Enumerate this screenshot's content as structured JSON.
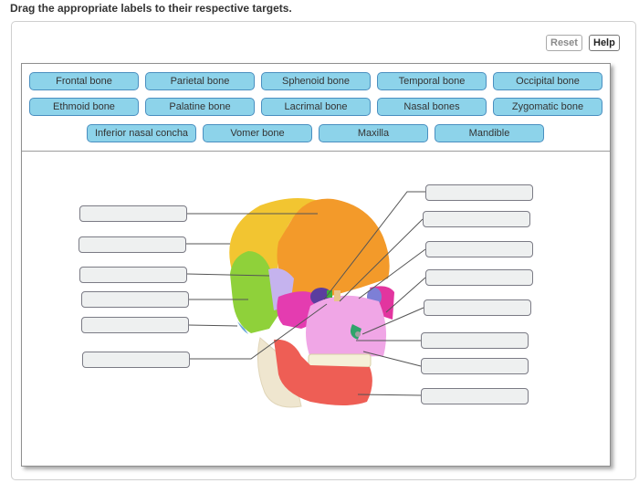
{
  "instruction": "Drag the appropriate labels to their respective targets.",
  "toolbar": {
    "reset_label": "Reset",
    "help_label": "Help"
  },
  "label_bank": [
    "Frontal bone",
    "Parietal bone",
    "Sphenoid bone",
    "Temporal bone",
    "Occipital bone",
    "Ethmoid bone",
    "Palatine bone",
    "Lacrimal bone",
    "Nasal bones",
    "Zygomatic bone",
    "Inferior nasal concha",
    "Vomer bone",
    "Maxilla",
    "Mandible"
  ],
  "targets": {
    "left_count": 6,
    "right_count": 8,
    "values": [
      "",
      "",
      "",
      "",
      "",
      "",
      "",
      "",
      "",
      "",
      "",
      "",
      "",
      ""
    ]
  },
  "image": {
    "subject": "skull-lateral-anterior-view",
    "alt": "Colored human skull diagram"
  },
  "colors": {
    "chip_fill": "#8dd3ea",
    "chip_border": "#4a8fc0",
    "target_fill": "#eef0f0",
    "frontal": "#f39a2a",
    "parietal": "#f2c531",
    "temporal": "#8fd13a",
    "sphenoid": "#e43cb0",
    "maxilla": "#f0a6e6",
    "mandible": "#ee5e55",
    "zygomatic": "#e2359f"
  }
}
